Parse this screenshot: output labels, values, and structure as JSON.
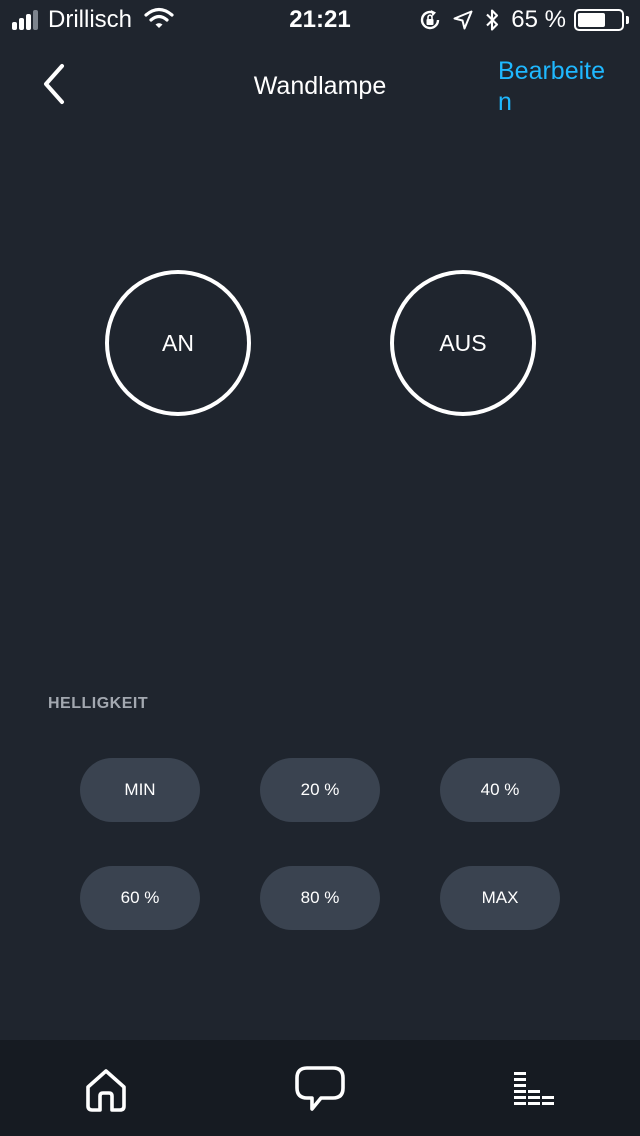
{
  "status_bar": {
    "carrier": "Drillisch",
    "time": "21:21",
    "battery_percent": "65 %",
    "battery_level": 0.65,
    "signal_bars_filled": 3,
    "signal_bars_total": 4
  },
  "nav": {
    "title": "Wandlampe",
    "edit_label": "Bearbeiten",
    "back_icon": "chevron-left-icon"
  },
  "power": {
    "on_label": "AN",
    "off_label": "AUS"
  },
  "brightness": {
    "section_label": "HELLIGKEIT",
    "options": [
      "MIN",
      "20 %",
      "40 %",
      "60 %",
      "80 %",
      "MAX"
    ]
  },
  "tab_bar": {
    "items": [
      {
        "icon": "home-icon"
      },
      {
        "icon": "chat-bubble-icon"
      },
      {
        "icon": "play-equalizer-icon"
      }
    ]
  },
  "colors": {
    "background": "#1f252e",
    "accent": "#1fb8ff",
    "pill": "#3a4350",
    "tab_bar": "#161b22"
  }
}
